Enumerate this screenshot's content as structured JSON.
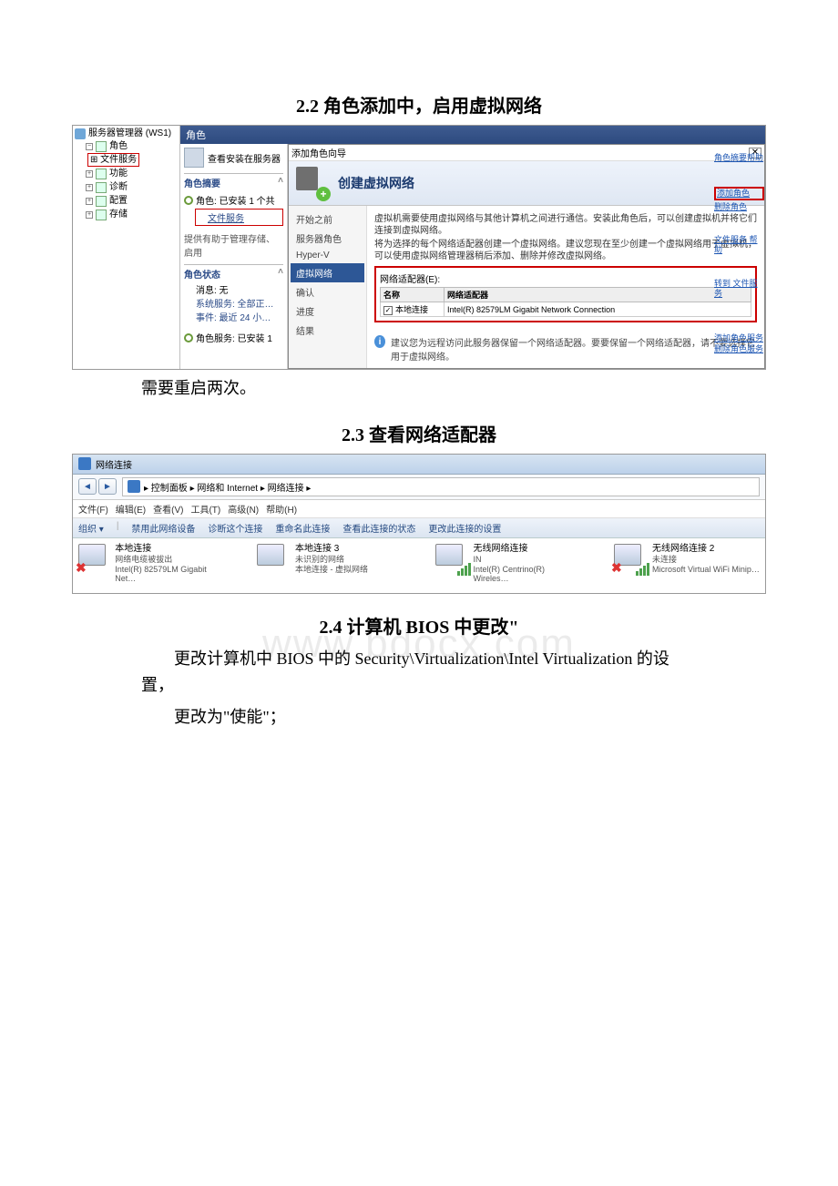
{
  "sections": {
    "s22": "2.2 角色添加中，启用虚拟网络",
    "s23": "2.3 查看网络适配器",
    "s24": "2.4 计算机 BIOS 中更改\"",
    "reboot_note": "需要重启两次。",
    "p24a": "更改计算机中 BIOS 中的 Security\\Virtualization\\Intel Virtualization 的设置，",
    "p24b": "更改为\"使能\"；"
  },
  "watermark": "www.bdocx.com",
  "shot1": {
    "tree": {
      "root": "服务器管理器 (WS1)",
      "roles": "角色",
      "file_services": "文件服务",
      "features": "功能",
      "diagnostics": "诊断",
      "config": "配置",
      "storage": "存储"
    },
    "rolesbar": "角色",
    "summary": {
      "view_roles": "查看安装在服务器",
      "role_summary_hdr": "角色摘要",
      "roles_installed_prefix": "角色: 已安装 1 个共",
      "file_services": "文件服务",
      "help_text": "提供有助于管理存储、启用",
      "role_status_hdr": "角色状态",
      "msg": "消息: 无",
      "svc": "系统服务: 全部正…",
      "evt": "事件: 最近 24 小…",
      "roles_inst_1": "角色服务: 已安装 1"
    },
    "wizard": {
      "titlebar": "添加角色向导",
      "header": "创建虚拟网络",
      "steps": {
        "before": "开始之前",
        "server_roles": "服务器角色",
        "hyperv": "Hyper-V",
        "vnet": "虚拟网络",
        "confirm": "确认",
        "progress": "进度",
        "result": "结果"
      },
      "para1": "虚拟机需要使用虚拟网络与其他计算机之间进行通信。安装此角色后，可以创建虚拟机并将它们连接到虚拟网络。",
      "para2": "将为选择的每个网络适配器创建一个虚拟网络。建议您现在至少创建一个虚拟网络用于虚拟机，可以使用虚拟网络管理器稍后添加、删除并修改虚拟网络。",
      "adapters_label": "网络适配器(E):",
      "col_name": "名称",
      "col_adapter": "网络适配器",
      "row_name": "本地连接",
      "row_adapter": "Intel(R) 82579LM Gigabit Network Connection",
      "note": "建议您为远程访问此服务器保留一个网络适配器。要要保留一个网络适配器，请不要选择它用于虚拟网络。"
    },
    "sidelinks": {
      "help": "角色摘要帮助",
      "add_role": "添加角色",
      "remove_role": "删除角色",
      "fs_help": "文件服务 帮助",
      "goto_fs": "转到 文件服务",
      "add_role_svc": "添加角色服务",
      "remove_role_svc": "删除角色服务"
    }
  },
  "shot2": {
    "window_title": "网络连接",
    "breadcrumb": "▸ 控制面板 ▸ 网络和 Internet ▸ 网络连接 ▸",
    "menu": {
      "file": "文件(F)",
      "edit": "编辑(E)",
      "view": "查看(V)",
      "tools": "工具(T)",
      "advanced": "高级(N)",
      "help": "帮助(H)"
    },
    "toolbar": {
      "organize": "组织 ▾",
      "disable": "禁用此网络设备",
      "diagnose": "诊断这个连接",
      "rename": "重命名此连接",
      "status": "查看此连接的状态",
      "change": "更改此连接的设置"
    },
    "items": [
      {
        "title": "本地连接",
        "line2": "网络电缆被拔出",
        "line3": "Intel(R) 82579LM Gigabit Net…",
        "err": true,
        "wifi": false
      },
      {
        "title": "本地连接 3",
        "line2": "未识别的网络",
        "line3": "本地连接 - 虚拟网络",
        "err": false,
        "wifi": false
      },
      {
        "title": "无线网络连接",
        "line2": "IN",
        "line3": "Intel(R) Centrino(R) Wireles…",
        "err": false,
        "wifi": true
      },
      {
        "title": "无线网络连接 2",
        "line2": "未连接",
        "line3": "Microsoft Virtual WiFi Minip…",
        "err": true,
        "wifi": true
      }
    ]
  }
}
